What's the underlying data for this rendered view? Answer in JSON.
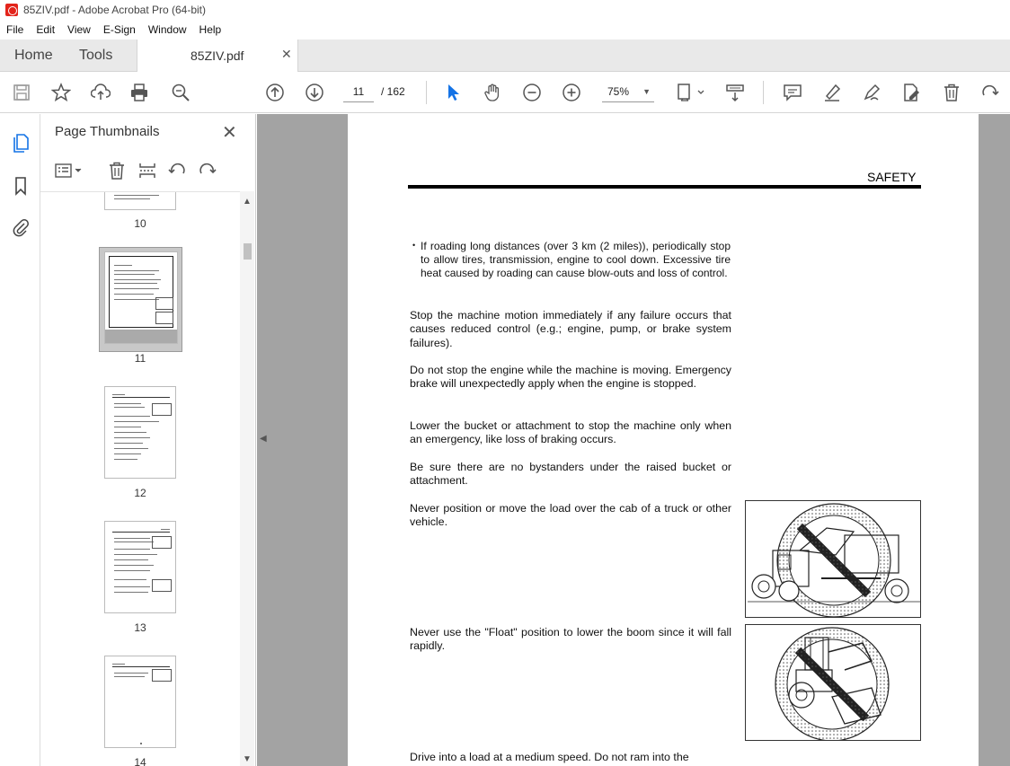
{
  "window": {
    "title": "85ZIV.pdf - Adobe Acrobat Pro (64-bit)"
  },
  "menu": {
    "items": [
      "File",
      "Edit",
      "View",
      "E-Sign",
      "Window",
      "Help"
    ]
  },
  "tabs": {
    "home": "Home",
    "tools": "Tools",
    "document": "85ZIV.pdf"
  },
  "toolbar": {
    "current_page": "11",
    "total_pages": "/ 162",
    "zoom": "75%"
  },
  "panel": {
    "title": "Page Thumbnails",
    "thumbnails": [
      {
        "label": "10"
      },
      {
        "label": "11"
      },
      {
        "label": "12"
      },
      {
        "label": "13"
      },
      {
        "label": "14"
      }
    ]
  },
  "document": {
    "header": "SAFETY",
    "bullet": "If roading long distances (over 3 km (2 miles)), periodically stop to allow tires, transmission, engine to cool down. Excessive tire heat caused by roading can cause blow-outs and loss of control.",
    "paragraphs": [
      "Stop the machine motion immediately if any failure occurs that causes reduced control (e.g.; engine, pump, or brake system failures).",
      "Do not stop the engine while the machine is moving. Emergency brake will unexpectedly apply when the engine is stopped.",
      "Lower the bucket or attachment to stop the machine only when an emergency, like loss of braking occurs.",
      "Be sure there are no bystanders under the raised bucket or attachment.",
      "Never position or move the load over the cab of a truck or other vehicle.",
      "Never use the \"Float\" position to lower the boom since it will fall rapidly.",
      "Drive into a load at a medium speed.  Do not ram into the"
    ]
  },
  "colors": {
    "accent_blue": "#1473e6",
    "acrobat_red": "#e3241b",
    "doc_background": "#a3a3a3"
  }
}
